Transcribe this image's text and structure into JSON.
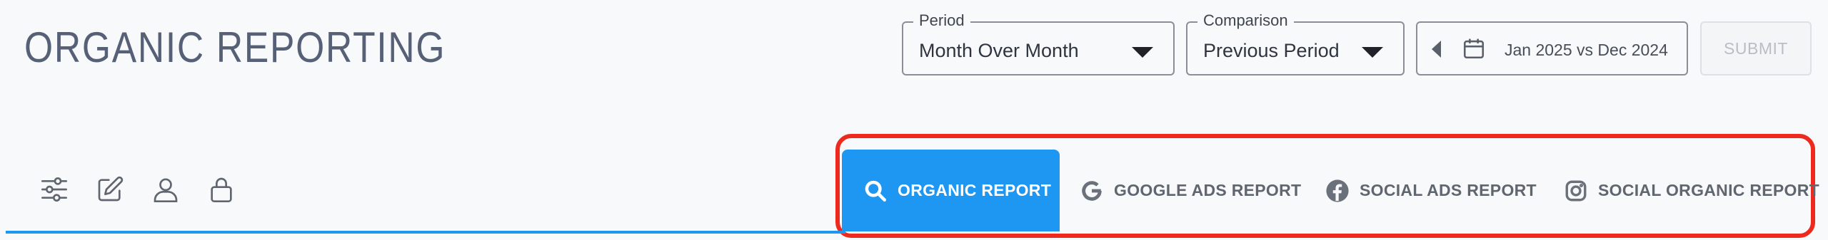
{
  "header": {
    "title": "ORGANIC REPORTING"
  },
  "filters": {
    "period": {
      "label": "Period",
      "value": "Month Over Month"
    },
    "comparison": {
      "label": "Comparison",
      "value": "Previous Period"
    },
    "date_range": {
      "value": "Jan 2025 vs Dec 2024"
    },
    "submit_label": "SUBMIT"
  },
  "toolbar": {
    "icons": [
      "sliders-icon",
      "edit-icon",
      "user-icon",
      "lock-icon"
    ]
  },
  "tabs": [
    {
      "label": "ORGANIC REPORT",
      "icon": "search-icon",
      "active": true
    },
    {
      "label": "GOOGLE ADS REPORT",
      "icon": "google-icon",
      "active": false
    },
    {
      "label": "SOCIAL ADS REPORT",
      "icon": "facebook-icon",
      "active": false
    },
    {
      "label": "SOCIAL ORGANIC REPORT",
      "icon": "instagram-icon",
      "active": false
    }
  ],
  "colors": {
    "accent": "#1e97f3",
    "highlight": "#ee2a1e",
    "title": "#566077"
  }
}
